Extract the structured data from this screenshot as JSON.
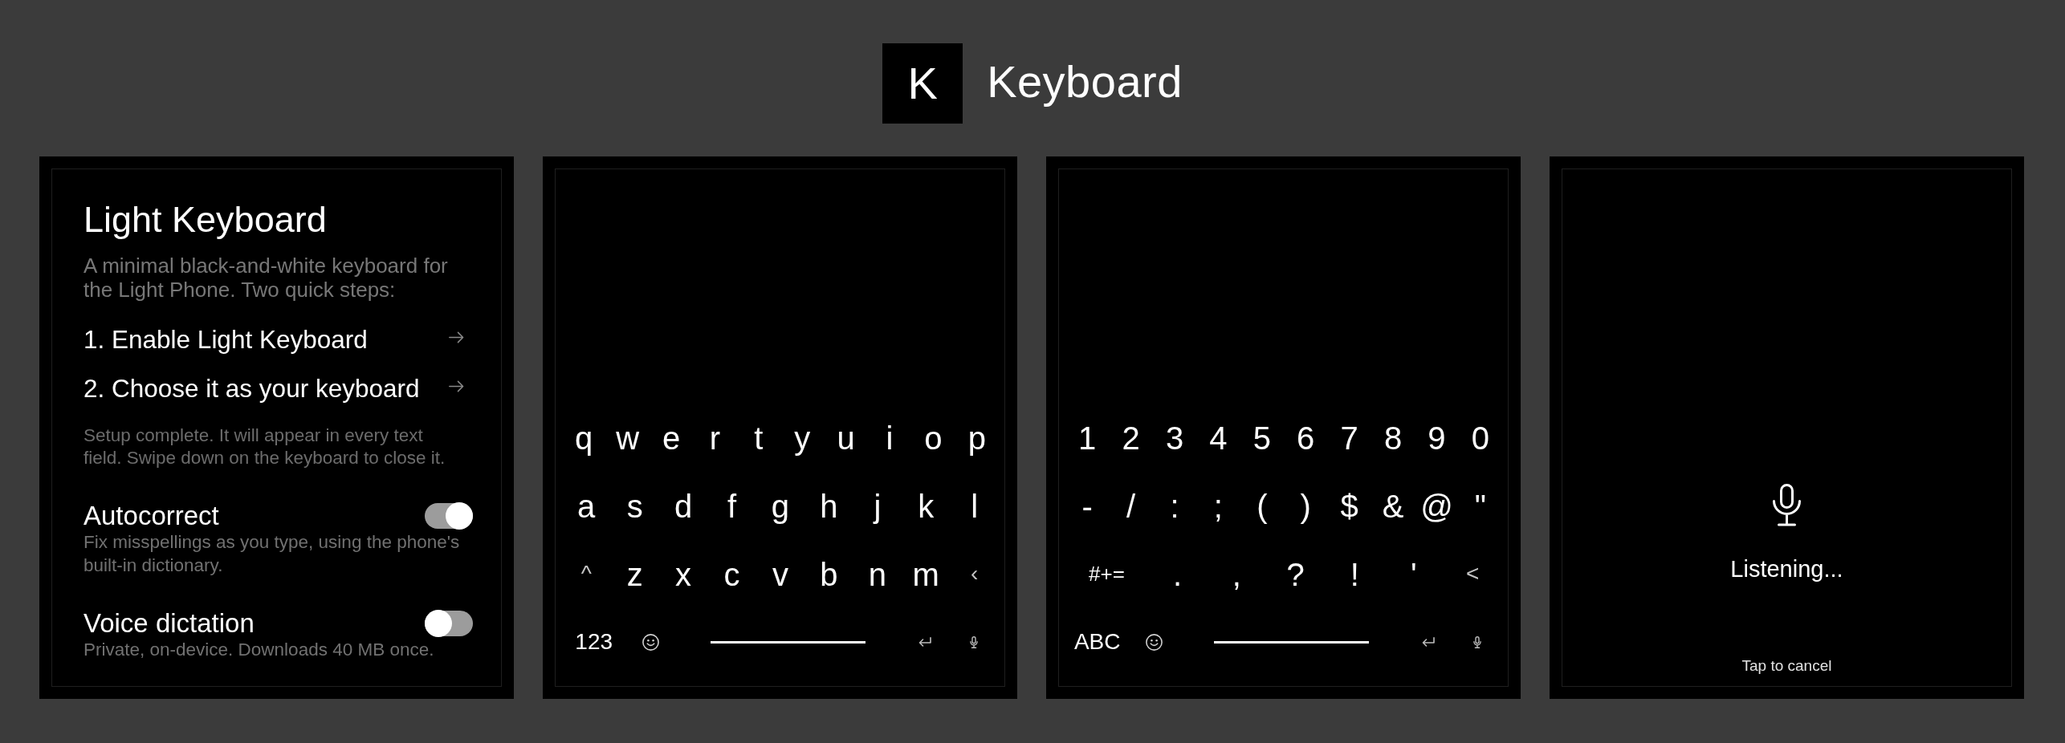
{
  "header": {
    "logo": "K",
    "title": "Keyboard"
  },
  "panels": [
    {
      "kind": "setup",
      "title": "Light Keyboard",
      "description": "A minimal black-and-white keyboard for the Light Phone. Two quick steps:",
      "steps": [
        {
          "label": "1. Enable Light Keyboard"
        },
        {
          "label": "2. Choose it as your keyboard"
        }
      ],
      "note": "Setup complete. It will appear in every text field. Swipe down on the keyboard to close it.",
      "settings": [
        {
          "label": "Autocorrect",
          "description": "Fix misspellings as you type, using the phone's built-in dictionary.",
          "on": true
        },
        {
          "label": "Voice dictation",
          "description": "Private, on-device. Downloads 40 MB once.",
          "on": false
        }
      ]
    },
    {
      "kind": "keyboard",
      "key_rows": [
        {
          "keys": [
            {
              "kind": "char",
              "label": "q"
            },
            {
              "kind": "char",
              "label": "w"
            },
            {
              "kind": "char",
              "label": "e"
            },
            {
              "kind": "char",
              "label": "r"
            },
            {
              "kind": "char",
              "label": "t"
            },
            {
              "kind": "char",
              "label": "y"
            },
            {
              "kind": "char",
              "label": "u"
            },
            {
              "kind": "char",
              "label": "i"
            },
            {
              "kind": "char",
              "label": "o"
            },
            {
              "kind": "char",
              "label": "p"
            }
          ]
        },
        {
          "keys": [
            {
              "kind": "char",
              "label": "a"
            },
            {
              "kind": "char",
              "label": "s"
            },
            {
              "kind": "char",
              "label": "d"
            },
            {
              "kind": "char",
              "label": "f"
            },
            {
              "kind": "char",
              "label": "g"
            },
            {
              "kind": "char",
              "label": "h"
            },
            {
              "kind": "char",
              "label": "j"
            },
            {
              "kind": "char",
              "label": "k"
            },
            {
              "kind": "char",
              "label": "l"
            }
          ]
        },
        {
          "keys": [
            {
              "kind": "shift",
              "label": "^"
            },
            {
              "kind": "char",
              "label": "z"
            },
            {
              "kind": "char",
              "label": "x"
            },
            {
              "kind": "char",
              "label": "c"
            },
            {
              "kind": "char",
              "label": "v"
            },
            {
              "kind": "char",
              "label": "b"
            },
            {
              "kind": "char",
              "label": "n"
            },
            {
              "kind": "char",
              "label": "m"
            },
            {
              "kind": "backspace",
              "label": "‹"
            }
          ]
        },
        {
          "keys": [
            {
              "kind": "mode",
              "label": "123"
            },
            {
              "kind": "emoji"
            },
            {
              "kind": "space"
            },
            {
              "kind": "return"
            },
            {
              "kind": "mic"
            }
          ]
        }
      ]
    },
    {
      "kind": "keyboard",
      "key_rows": [
        {
          "keys": [
            {
              "kind": "char",
              "label": "1"
            },
            {
              "kind": "char",
              "label": "2"
            },
            {
              "kind": "char",
              "label": "3"
            },
            {
              "kind": "char",
              "label": "4"
            },
            {
              "kind": "char",
              "label": "5"
            },
            {
              "kind": "char",
              "label": "6"
            },
            {
              "kind": "char",
              "label": "7"
            },
            {
              "kind": "char",
              "label": "8"
            },
            {
              "kind": "char",
              "label": "9"
            },
            {
              "kind": "char",
              "label": "0"
            }
          ]
        },
        {
          "keys": [
            {
              "kind": "char",
              "label": "-"
            },
            {
              "kind": "char",
              "label": "/"
            },
            {
              "kind": "char",
              "label": ":"
            },
            {
              "kind": "char",
              "label": ";"
            },
            {
              "kind": "char",
              "label": "("
            },
            {
              "kind": "char",
              "label": ")"
            },
            {
              "kind": "char",
              "label": "$"
            },
            {
              "kind": "char",
              "label": "&"
            },
            {
              "kind": "char",
              "label": "@"
            },
            {
              "kind": "char",
              "label": "\""
            }
          ]
        },
        {
          "keys": [
            {
              "kind": "symbols",
              "label": "#+="
            },
            {
              "kind": "char",
              "label": "."
            },
            {
              "kind": "char",
              "label": ","
            },
            {
              "kind": "char",
              "label": "?"
            },
            {
              "kind": "char",
              "label": "!"
            },
            {
              "kind": "char",
              "label": "'"
            },
            {
              "kind": "backspace",
              "label": "<"
            }
          ]
        },
        {
          "keys": [
            {
              "kind": "mode",
              "label": "ABC"
            },
            {
              "kind": "emoji"
            },
            {
              "kind": "space"
            },
            {
              "kind": "return"
            },
            {
              "kind": "mic"
            }
          ]
        }
      ]
    },
    {
      "kind": "dictation",
      "status": "Listening...",
      "hint": "Tap to cancel"
    }
  ]
}
